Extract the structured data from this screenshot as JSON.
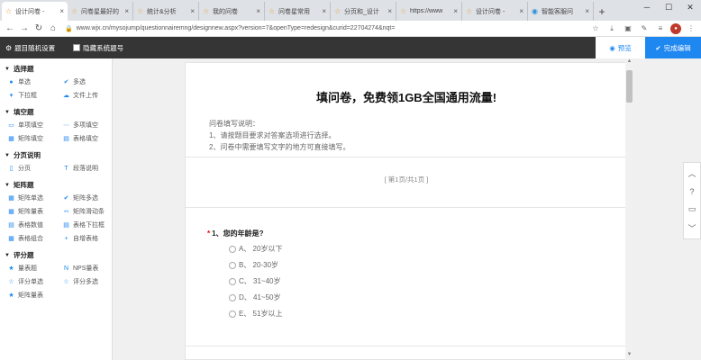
{
  "browser": {
    "tabs": [
      {
        "title": "设计问卷 -",
        "icon": "star-icon",
        "active": true
      },
      {
        "title": "问卷星最好的",
        "icon": "star-icon",
        "active": false
      },
      {
        "title": "统计&分析",
        "icon": "star-icon",
        "active": false
      },
      {
        "title": "我的问卷",
        "icon": "star-icon",
        "active": false
      },
      {
        "title": "问卷星常用",
        "icon": "star-icon",
        "active": false
      },
      {
        "title": "分页和_设计",
        "icon": "star-icon",
        "active": false
      },
      {
        "title": "https://www",
        "icon": "star-icon",
        "active": false
      },
      {
        "title": "设计问卷 -",
        "icon": "star-icon",
        "active": false
      },
      {
        "title": "智能客服问",
        "icon": "chat-icon",
        "active": false
      }
    ],
    "new_tab": "+",
    "url": "https://www.wjx.cn/mysojump/questionnairemng/designnew.aspx?version=7&openType=redesign&curid=22704274&nqt=",
    "url_display": "www.wjx.cn/mysojump/questionnairemng/designnew.aspx?version=7&openType=redesign&curid=22704274&nqt="
  },
  "toolbar": {
    "random_settings": "题目随机设置",
    "hide_numbers": "隐藏系统题号",
    "preview": "预览",
    "done": "完成编辑"
  },
  "sidebar": {
    "sections": [
      {
        "title": "选择题",
        "items": [
          {
            "label": "单选",
            "icon": "dot-icon"
          },
          {
            "label": "多选",
            "icon": "check-icon"
          },
          {
            "label": "下拉框",
            "icon": "dropdown-icon"
          },
          {
            "label": "文件上传",
            "icon": "upload-icon"
          }
        ]
      },
      {
        "title": "填空题",
        "items": [
          {
            "label": "单项填空",
            "icon": "text-icon"
          },
          {
            "label": "多项填空",
            "icon": "multi-text-icon"
          },
          {
            "label": "矩阵填空",
            "icon": "matrix-icon"
          },
          {
            "label": "表格填空",
            "icon": "table-icon"
          }
        ]
      },
      {
        "title": "分页说明",
        "items": [
          {
            "label": "分页",
            "icon": "page-icon"
          },
          {
            "label": "段落说明",
            "icon": "paragraph-icon"
          }
        ]
      },
      {
        "title": "矩阵题",
        "items": [
          {
            "label": "矩阵单选",
            "icon": "matrix-radio-icon"
          },
          {
            "label": "矩阵多选",
            "icon": "matrix-check-icon"
          },
          {
            "label": "矩阵量表",
            "icon": "matrix-scale-icon"
          },
          {
            "label": "矩阵滑动条",
            "icon": "slider-icon"
          },
          {
            "label": "表格数值",
            "icon": "table-number-icon"
          },
          {
            "label": "表格下拉框",
            "icon": "table-dropdown-icon"
          },
          {
            "label": "表格组合",
            "icon": "table-combo-icon"
          },
          {
            "label": "自增表格",
            "icon": "plus-icon"
          }
        ]
      },
      {
        "title": "评分题",
        "items": [
          {
            "label": "量表题",
            "icon": "star-icon"
          },
          {
            "label": "NPS量表",
            "icon": "nps-icon"
          },
          {
            "label": "评分单选",
            "icon": "star-outline-icon"
          },
          {
            "label": "评分多选",
            "icon": "star-outline-icon"
          },
          {
            "label": "矩阵量表",
            "icon": "star-icon"
          }
        ]
      }
    ]
  },
  "survey": {
    "title": "填问卷，免费领1GB全国通用流量!",
    "desc_heading": "问卷填写说明：",
    "desc_line1": "1、请按题目要求对答案选项进行选择。",
    "desc_line2": "2、问卷中需要填写文字的地方可直接填写。",
    "page_info": "[ 第1页/共1页 ]",
    "question": {
      "required_mark": "*",
      "title": "1、您的年龄是?",
      "options": [
        "A、 20岁以下",
        "B、 20-30岁",
        "C、 31~40岁",
        "D、 41~50岁",
        "E、 51岁以上"
      ]
    }
  }
}
